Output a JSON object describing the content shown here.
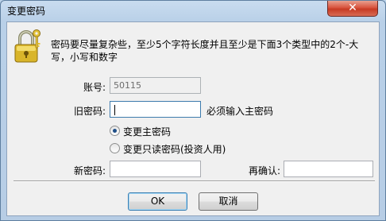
{
  "window": {
    "title": "变更密码",
    "close_glyph": "✕"
  },
  "description": "密码要尽量复杂些，至少5个字符长度并且至少是下面3个类型中的2个-大写，小写和数字",
  "account": {
    "label": "账号:",
    "value": "50115"
  },
  "old_password": {
    "label": "旧密码:",
    "value": "",
    "hint": "必须输入主密码"
  },
  "options": [
    {
      "label": "变更主密码",
      "checked": true
    },
    {
      "label": "变更只读密码(投资人用)",
      "checked": false
    }
  ],
  "new_password": {
    "label": "新密码:",
    "value": ""
  },
  "confirm": {
    "label": "再确认:",
    "value": ""
  },
  "buttons": {
    "ok": "OK",
    "cancel": "取消"
  },
  "icons": {
    "dialog": "lock-with-keys-icon",
    "close": "close-icon"
  },
  "colors": {
    "title_bar": "#bcd3ea",
    "close_button": "#c73b23",
    "client_bg": "#f0f0f0"
  }
}
